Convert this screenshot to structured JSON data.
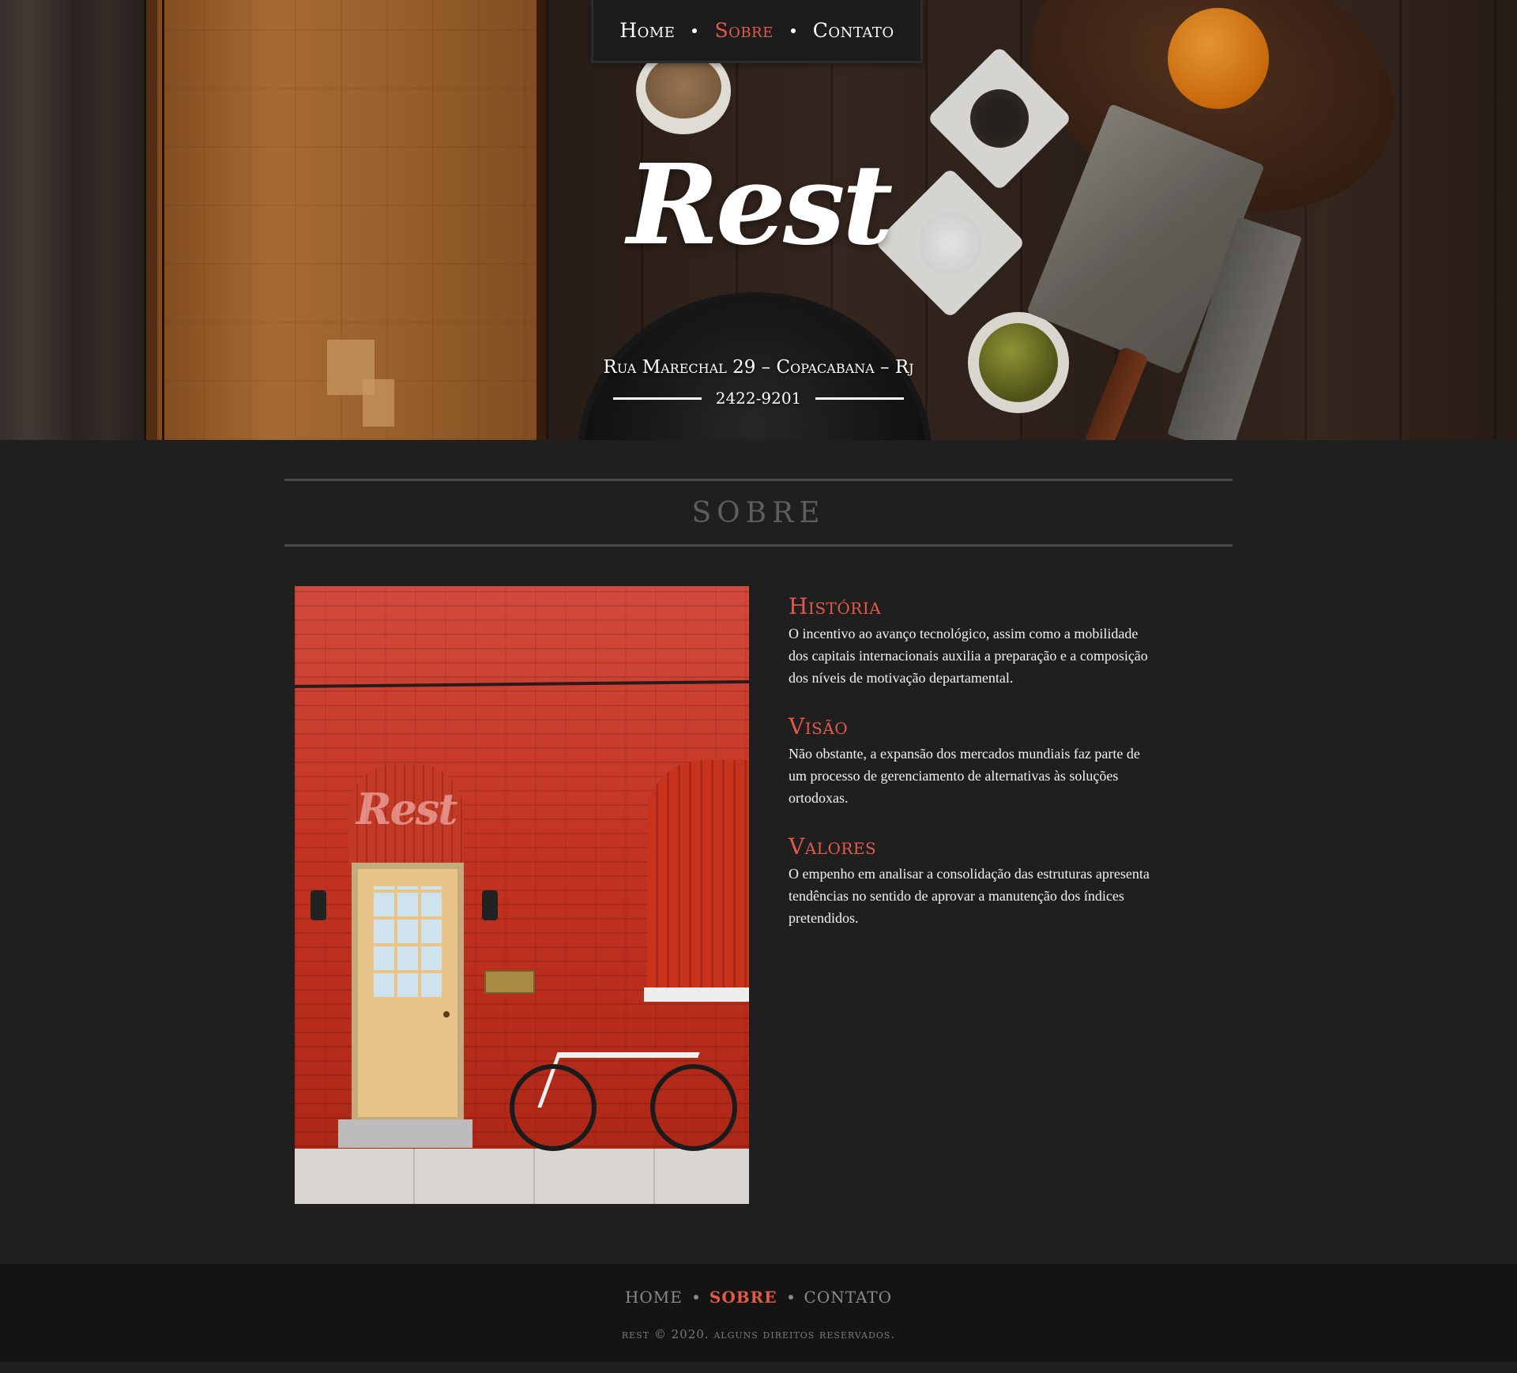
{
  "nav": {
    "items": [
      {
        "label": "Home",
        "active": false
      },
      {
        "label": "Sobre",
        "active": true
      },
      {
        "label": "Contato",
        "active": false
      }
    ]
  },
  "hero": {
    "logo": "Rest",
    "address": "Rua Marechal 29 – Copacabana – Rj",
    "phone": "2422-9201"
  },
  "about": {
    "title": "SOBRE",
    "photo_sign": "Rest",
    "blocks": [
      {
        "heading": "História",
        "text": "O incentivo ao avanço tecnológico, assim como a mobilidade dos capitais internacionais auxilia a preparação e a composição dos níveis de motivação departamental."
      },
      {
        "heading": "Visão",
        "text": "Não obstante, a expansão dos mercados mundiais faz parte de um processo de gerenciamento de alternativas às soluções ortodoxas."
      },
      {
        "heading": "Valores",
        "text": "O empenho em analisar a consolidação das estruturas apresenta tendências no sentido de aprovar a manutenção dos índices pretendidos."
      }
    ]
  },
  "footer": {
    "nav": [
      "HOME",
      "SOBRE",
      "CONTATO"
    ],
    "copyright": "rest © 2020. alguns direitos reservados."
  },
  "colors": {
    "accent": "#e25a4a",
    "background": "#1f1f1f",
    "footer": "#141414"
  }
}
